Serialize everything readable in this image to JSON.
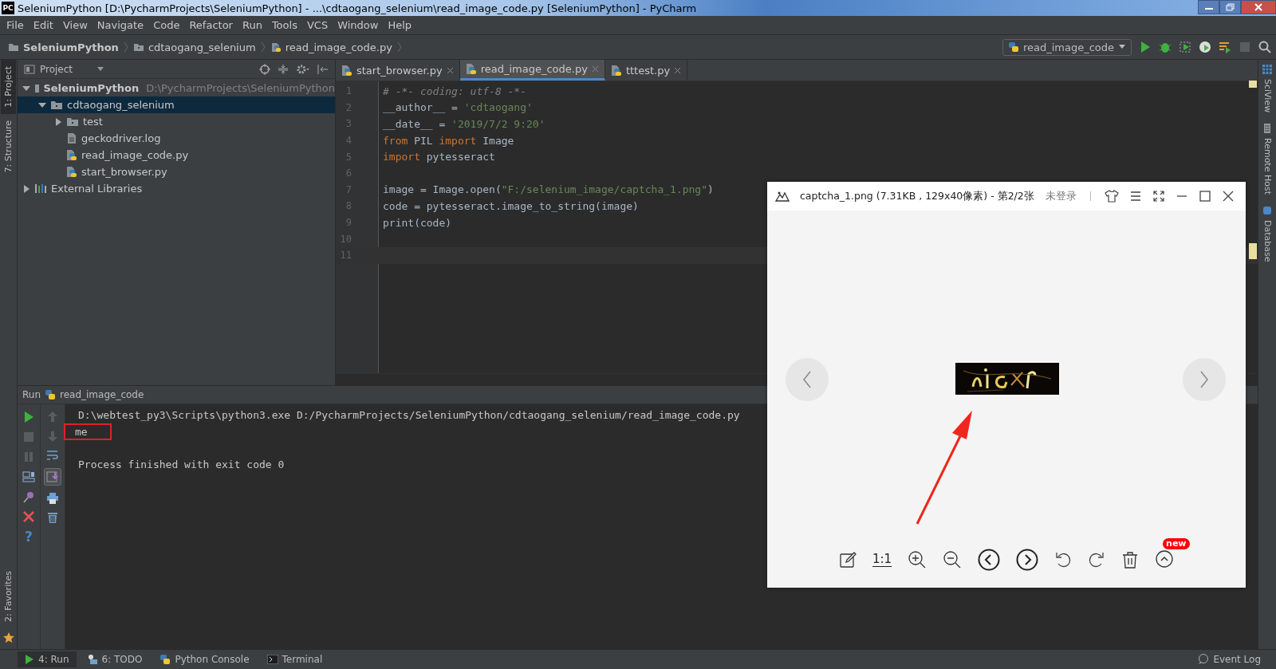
{
  "window": {
    "title": "SeleniumPython [D:\\PycharmProjects\\SeleniumPython] - ...\\cdtaogang_selenium\\read_image_code.py [SeleniumPython] - PyCharm",
    "app_badge": "PC"
  },
  "menu": [
    "File",
    "Edit",
    "View",
    "Navigate",
    "Code",
    "Refactor",
    "Run",
    "Tools",
    "VCS",
    "Window",
    "Help"
  ],
  "breadcrumbs": [
    {
      "label": "SeleniumPython",
      "kind": "project"
    },
    {
      "label": "cdtaogang_selenium",
      "kind": "folder"
    },
    {
      "label": "read_image_code.py",
      "kind": "python"
    }
  ],
  "run_config": "read_image_code",
  "left_stripe_top": [
    {
      "label": "1: Project",
      "selected": true
    },
    {
      "label": "7: Structure",
      "selected": false
    }
  ],
  "left_stripe_bottom": [
    {
      "label": "2: Favorites",
      "selected": false
    }
  ],
  "right_stripe": [
    "SciView",
    "Remote Host",
    "Database"
  ],
  "project_panel": {
    "title": "Project",
    "tree": [
      {
        "label": "SeleniumPython",
        "path": "D:\\PycharmProjects\\SeleniumPython",
        "kind": "project",
        "expanded": true,
        "selected": false,
        "children": [
          {
            "label": "cdtaogang_selenium",
            "kind": "folder",
            "expanded": true,
            "selected": true,
            "children": [
              {
                "label": "test",
                "kind": "folder",
                "expanded": false,
                "selected": false
              },
              {
                "label": "geckodriver.log",
                "kind": "log",
                "selected": false
              },
              {
                "label": "read_image_code.py",
                "kind": "python",
                "selected": false
              },
              {
                "label": "start_browser.py",
                "kind": "python",
                "selected": false
              }
            ]
          }
        ]
      },
      {
        "label": "External Libraries",
        "kind": "libraries",
        "expanded": false,
        "selected": false
      }
    ]
  },
  "editor_tabs": [
    {
      "label": "start_browser.py",
      "selected": false
    },
    {
      "label": "read_image_code.py",
      "selected": true
    },
    {
      "label": "tttest.py",
      "selected": false
    }
  ],
  "code_lines": [
    {
      "number": "1",
      "current": false,
      "tokens": [
        {
          "kind": "comment",
          "text": "# -*- coding: utf-8 -*-"
        }
      ]
    },
    {
      "number": "2",
      "current": false,
      "tokens": [
        {
          "kind": "plain",
          "text": "__author__ = "
        },
        {
          "kind": "string",
          "text": "'cdtaogang'"
        }
      ]
    },
    {
      "number": "3",
      "current": false,
      "tokens": [
        {
          "kind": "plain",
          "text": "__date__ = "
        },
        {
          "kind": "string",
          "text": "'2019/7/2 9:20'"
        }
      ]
    },
    {
      "number": "4",
      "current": false,
      "tokens": [
        {
          "kind": "keyword",
          "text": "from"
        },
        {
          "kind": "plain",
          "text": " PIL "
        },
        {
          "kind": "keyword",
          "text": "import"
        },
        {
          "kind": "plain",
          "text": " Image"
        }
      ]
    },
    {
      "number": "5",
      "current": false,
      "tokens": [
        {
          "kind": "keyword",
          "text": "import"
        },
        {
          "kind": "plain",
          "text": " pytesseract"
        }
      ]
    },
    {
      "number": "6",
      "current": false
    },
    {
      "number": "7",
      "current": false,
      "tokens": [
        {
          "kind": "plain",
          "text": "image = Image.open("
        },
        {
          "kind": "string",
          "text": "\"F:/selenium_image/captcha_1.png\""
        },
        {
          "kind": "plain",
          "text": ")"
        }
      ]
    },
    {
      "number": "8",
      "current": false,
      "tokens": [
        {
          "kind": "plain",
          "text": "code = pytesseract.image_to_string(image)"
        }
      ]
    },
    {
      "number": "9",
      "current": false,
      "tokens": [
        {
          "kind": "plain",
          "text": "print(code)"
        }
      ]
    },
    {
      "number": "10",
      "current": false
    },
    {
      "number": "11",
      "current": true
    }
  ],
  "run_panel": {
    "label": "Run",
    "config": "read_image_code",
    "help_glyph": "?",
    "lines": [
      {
        "text": "D:\\webtest_py3\\Scripts\\python3.exe D:/PycharmProjects/SeleniumPython/cdtaogang_selenium/read_image_code.py",
        "boxed": false
      },
      {
        "text": "me",
        "boxed": true
      }
    ],
    "exit_message": "Process finished with exit code 0"
  },
  "bottom_tabs": [
    {
      "label": "4: Run",
      "kind": "run",
      "selected": true
    },
    {
      "label": "6: TODO",
      "kind": "todo",
      "selected": false
    },
    {
      "label": "Python Console",
      "kind": "console",
      "selected": false
    },
    {
      "label": "Terminal",
      "kind": "terminal",
      "selected": false
    }
  ],
  "event_log": "Event Log",
  "image_viewer": {
    "title": "captcha_1.png (7.31KB , 129x40像素) - 第2/2张",
    "login": "未登录",
    "actual_size": "1:1",
    "badge": "new"
  }
}
